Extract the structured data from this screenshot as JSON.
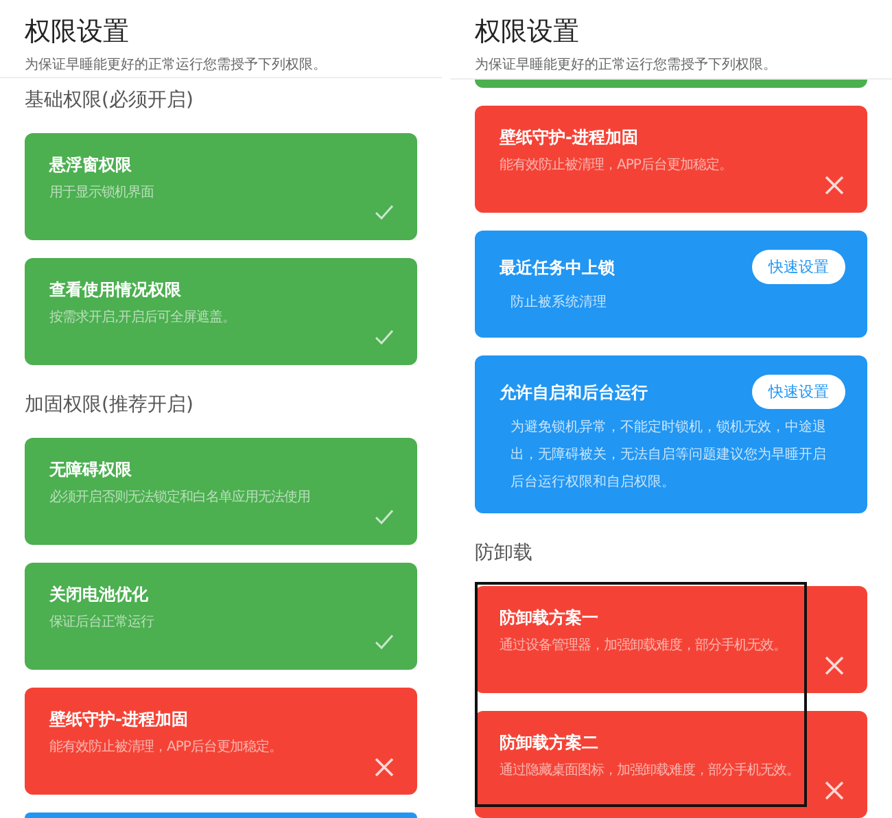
{
  "screens": [
    {
      "title": "权限设置",
      "subtitle": "为保证早睡能更好的正常运行您需授予下列权限。",
      "content": [
        {
          "kind": "section",
          "label": "基础权限(必须开启)"
        },
        {
          "kind": "granted",
          "title": "悬浮窗权限",
          "description": "用于显示锁机界面"
        },
        {
          "kind": "granted",
          "title": "查看使用情况权限",
          "description": "按需求开启,开启后可全屏遮盖。"
        },
        {
          "kind": "section",
          "label": "加固权限(推荐开启)"
        },
        {
          "kind": "granted",
          "title": "无障碍权限",
          "description": "必须开启否则无法锁定和白名单应用无法使用"
        },
        {
          "kind": "granted",
          "title": "关闭电池优化",
          "description": "保证后台正常运行"
        },
        {
          "kind": "denied",
          "title": "壁纸守护-进程加固",
          "description": "能有效防止被清理，APP后台更加稳定。"
        },
        {
          "kind": "action",
          "cut_off": true
        }
      ]
    },
    {
      "title": "权限设置",
      "subtitle": "为保证早睡能更好的正常运行您需授予下列权限。",
      "content": [
        {
          "kind": "granted",
          "cut_off": true
        },
        {
          "kind": "denied",
          "title": "壁纸守护-进程加固",
          "description": "能有效防止被清理，APP后台更加稳定。"
        },
        {
          "kind": "action",
          "title": "最近任务中上锁",
          "description": "防止被系统清理",
          "button": "快速设置"
        },
        {
          "kind": "action",
          "title": "允许自启和后台运行",
          "description": "为避免锁机异常，不能定时锁机，锁机无效，中途退出，无障碍被关，无法自启等问题建议您为早睡开启后台运行权限和自启权限。",
          "button": "快速设置"
        },
        {
          "kind": "section",
          "label": "防卸载"
        },
        {
          "kind": "denied",
          "title": "防卸载方案一",
          "description": "通过设备管理器，加强卸载难度，部分手机无效。"
        },
        {
          "kind": "denied",
          "title": "防卸载方案二",
          "description": "通过隐藏桌面图标，加强卸载难度，部分手机无效。"
        }
      ]
    }
  ]
}
